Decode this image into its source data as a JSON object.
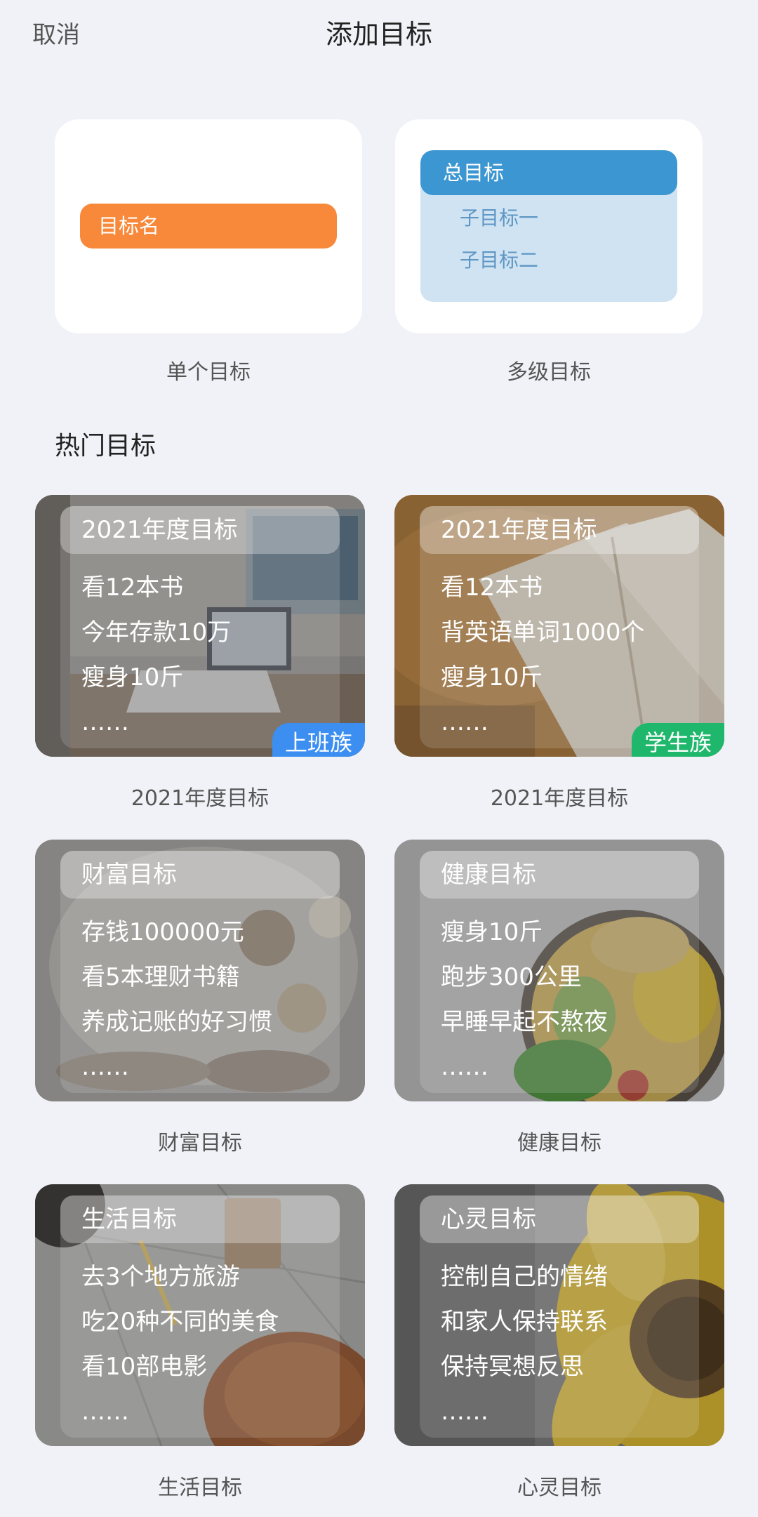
{
  "header": {
    "cancel_label": "取消",
    "title": "添加目标"
  },
  "goal_types": {
    "single": {
      "pill_text": "目标名",
      "label": "单个目标"
    },
    "multi": {
      "head_text": "总目标",
      "sub1": "子目标一",
      "sub2": "子目标二",
      "label": "多级目标"
    }
  },
  "section_title": "热门目标",
  "cards": [
    {
      "title": "2021年度目标",
      "items": [
        "看12本书",
        "今年存款10万",
        "瘦身10斤",
        "……"
      ],
      "badge": "上班族",
      "badge_color": "#3c8ff0",
      "label": "2021年度目标"
    },
    {
      "title": "2021年度目标",
      "items": [
        "看12本书",
        "背英语单词1000个",
        "瘦身10斤",
        "……"
      ],
      "badge": "学生族",
      "badge_color": "#1fb76b",
      "label": "2021年度目标"
    },
    {
      "title": "财富目标",
      "items": [
        "存钱100000元",
        "看5本理财书籍",
        "养成记账的好习惯",
        "……"
      ],
      "label": "财富目标"
    },
    {
      "title": "健康目标",
      "items": [
        "瘦身10斤",
        "跑步300公里",
        "早睡早起不熬夜",
        "……"
      ],
      "label": "健康目标"
    },
    {
      "title": "生活目标",
      "items": [
        "去3个地方旅游",
        "吃20种不同的美食",
        "看10部电影",
        "……"
      ],
      "label": "生活目标"
    },
    {
      "title": "心灵目标",
      "items": [
        "控制自己的情绪",
        "和家人保持联系",
        "保持冥想反思",
        "……"
      ],
      "label": "心灵目标"
    }
  ],
  "colors": {
    "background": "#f1f2f7",
    "single_pill": "#f8883a",
    "multi_head": "#3b96d1",
    "multi_box": "#cfe3f3"
  }
}
